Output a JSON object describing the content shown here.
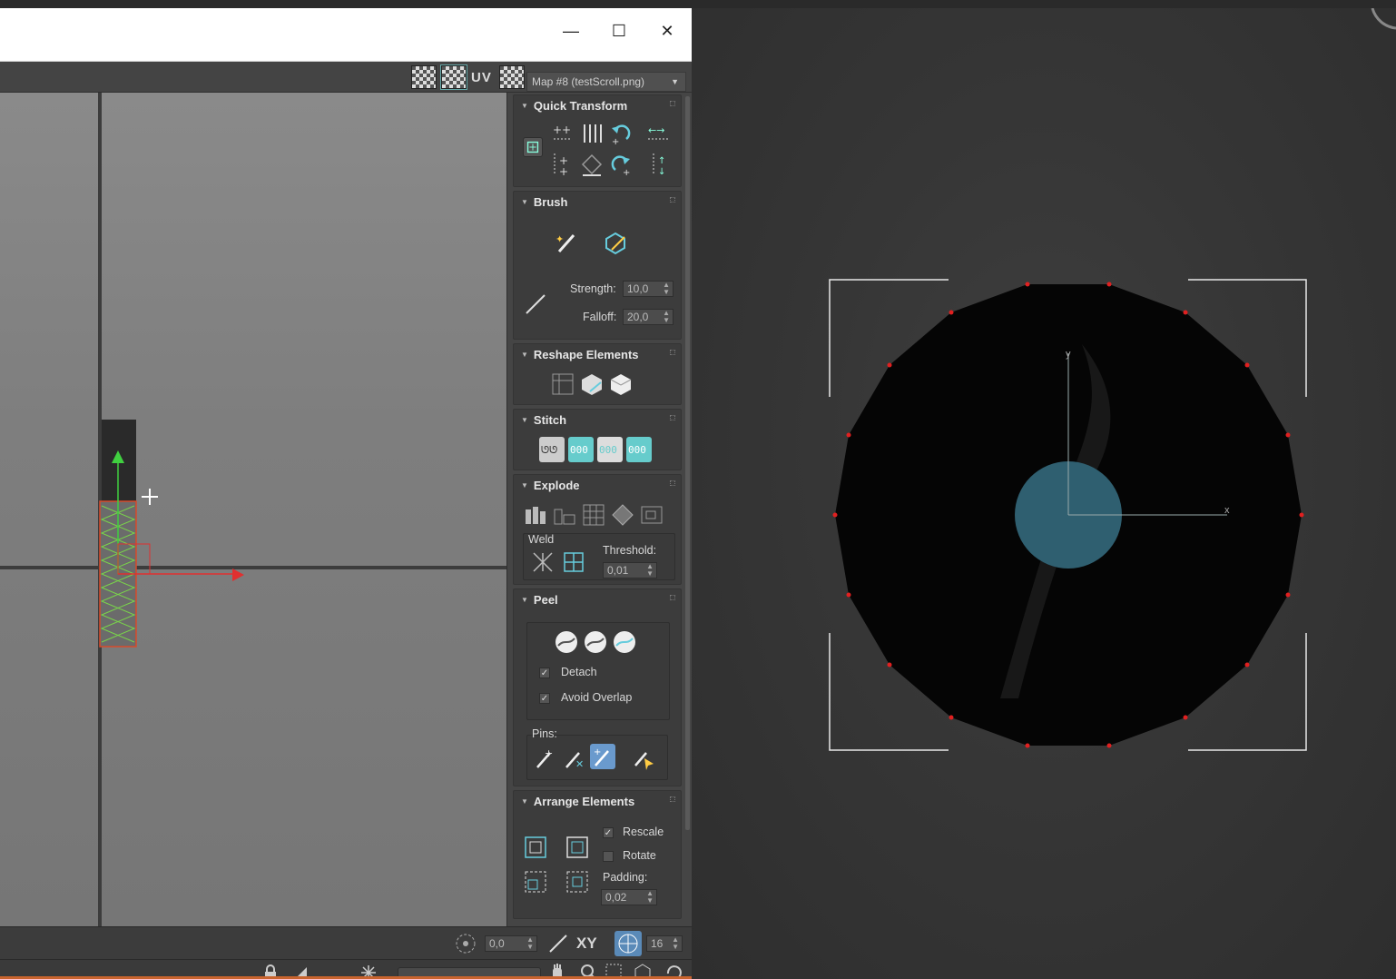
{
  "window": {
    "minimize_glyph": "—",
    "maximize_glyph": "☐",
    "close_glyph": "✕"
  },
  "toolbar": {
    "uv_label": "UV",
    "map_select": "Map #8 (testScroll.png)"
  },
  "panel": {
    "quick_transform": {
      "title": "Quick Transform"
    },
    "brush": {
      "title": "Brush",
      "strength_label": "Strength:",
      "strength_value": "10,0",
      "falloff_label": "Falloff:",
      "falloff_value": "20,0"
    },
    "reshape_elements": {
      "title": "Reshape Elements"
    },
    "stitch": {
      "title": "Stitch"
    },
    "explode": {
      "title": "Explode",
      "weld_label": "Weld",
      "threshold_label": "Threshold:",
      "threshold_value": "0,01"
    },
    "peel": {
      "title": "Peel",
      "detach_label": "Detach",
      "avoid_overlap_label": "Avoid Overlap",
      "pins_label": "Pins:",
      "detach_checked": true,
      "avoid_overlap_checked": true
    },
    "arrange_elements": {
      "title": "Arrange Elements",
      "rescale_label": "Rescale",
      "rotate_label": "Rotate",
      "padding_label": "Padding:",
      "padding_value": "0,02",
      "rescale_checked": true,
      "rotate_checked": false
    }
  },
  "statusbar": {
    "angle_value": "0,0",
    "xy_label": "XY",
    "grid_value": "16"
  },
  "viewport": {
    "axis_x": "x",
    "axis_y": "y",
    "disc_color": "#050505",
    "center_color": "#2f5f70",
    "vertex_color": "#e02020"
  },
  "colors": {
    "panel_bg": "#454545",
    "uv_bg": "#858585",
    "uv_shell": "#7ad64a",
    "gizmo_x": "#e03030",
    "gizmo_y": "#40d040"
  },
  "icons": [
    "quick-transform-icons",
    "brush-icons",
    "reshape-icons",
    "stitch-icons",
    "explode-icons",
    "peel-icons",
    "pin-icons",
    "arrange-icons"
  ]
}
